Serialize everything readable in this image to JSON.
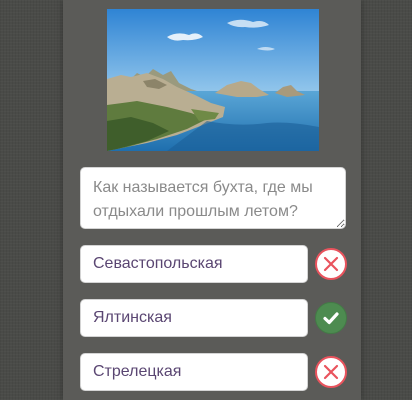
{
  "image": {
    "description_icon": "landscape-photo-bay"
  },
  "question": {
    "text": "Как называется бухта, где мы отдыхали прошлым летом?"
  },
  "answers": [
    {
      "label": "Севастопольская",
      "status": "wrong",
      "status_icon": "cross-icon"
    },
    {
      "label": "Ялтинская",
      "status": "correct",
      "status_icon": "check-icon"
    },
    {
      "label": "Стрелецкая",
      "status": "wrong",
      "status_icon": "cross-icon"
    }
  ],
  "colors": {
    "background": "#4a4b48",
    "panel": "#5b5b58",
    "answer_text": "#5a4672",
    "wrong": "#e9535d",
    "correct": "#4d8b50"
  }
}
